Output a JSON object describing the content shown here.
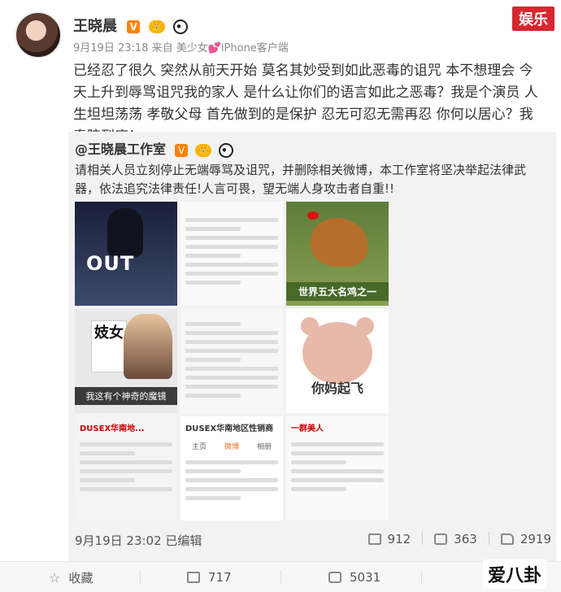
{
  "watermark_top": "娱乐",
  "post": {
    "author": "王晓晨",
    "meta": {
      "time": "9月19日 23:18",
      "from_prefix": "来自",
      "source": "美少女💕iPhone客户端"
    },
    "content": "已经忍了很久 突然从前天开始 莫名其妙受到如此恶毒的诅咒 本不想理会 今天上升到辱骂诅咒我的家人 是什么让你们的语言如此之恶毒？我是个演员 人生坦坦荡荡 孝敬父母 首先做到的是保护 忍无可忍无需再忍 你何以居心？我奉陪到底！"
  },
  "repost": {
    "author": "@王晓晨工作室",
    "text": "请相关人员立刻停止无端辱骂及诅咒，并删除相关微博，本工作室将坚决举起法律武器，依法追究法律责任!人言可畏，望无端人身攻击者自重!!",
    "images": {
      "img1_caption": "OUT",
      "img3_caption": "世界五大名鸡之一",
      "img4_sign": "妓女",
      "img4_caption": "我这有个神奇的魔镜",
      "img6_caption": "你妈起飞",
      "img7_title": "DUSEX华南地...",
      "img8_title": "DUSEX华南地区性销商",
      "img8_tabs": [
        "主页",
        "微博",
        "相册"
      ],
      "img9_title": "一群美人"
    },
    "footer": {
      "time": "9月19日 23:02",
      "edited": "已编辑",
      "reposts": "912",
      "comments": "363",
      "likes": "2919"
    }
  },
  "bottom_bar": {
    "favorite": "收藏",
    "reposts": "717",
    "comments": "5031",
    "likes": ""
  },
  "brand_mark": "爱八卦"
}
